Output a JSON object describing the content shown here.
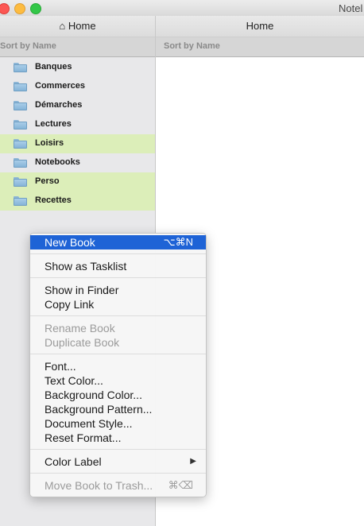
{
  "window": {
    "title": "Notel"
  },
  "left_pane": {
    "header": "⌂ Home",
    "sort_label": "Sort by Name",
    "items": [
      {
        "label": "Banques",
        "highlighted": false
      },
      {
        "label": "Commerces",
        "highlighted": false
      },
      {
        "label": "Démarches",
        "highlighted": false
      },
      {
        "label": "Lectures",
        "highlighted": false
      },
      {
        "label": "Loisirs",
        "highlighted": true
      },
      {
        "label": "Notebooks",
        "highlighted": false
      },
      {
        "label": "Perso",
        "highlighted": true
      },
      {
        "label": "Recettes",
        "highlighted": true
      }
    ]
  },
  "right_pane": {
    "header": "Home",
    "sort_label": "Sort by Name"
  },
  "context_menu": {
    "new_book": "New Book",
    "new_book_shortcut": "⌥⌘N",
    "show_as_tasklist": "Show as Tasklist",
    "show_in_finder": "Show in Finder",
    "copy_link": "Copy Link",
    "rename_book": "Rename Book",
    "duplicate_book": "Duplicate Book",
    "font": "Font...",
    "text_color": "Text Color...",
    "background_color": "Background Color...",
    "background_pattern": "Background Pattern...",
    "document_style": "Document Style...",
    "reset_format": "Reset Format...",
    "color_label": "Color Label",
    "move_to_trash": "Move Book to Trash...",
    "move_to_trash_shortcut": "⌘⌫"
  },
  "colors": {
    "highlight": "#dceeb9",
    "menu_selection": "#1e63d6",
    "folder": "#86b4d8"
  },
  "icons": [
    "folder-icon",
    "home-icon",
    "submenu-arrow-icon"
  ]
}
